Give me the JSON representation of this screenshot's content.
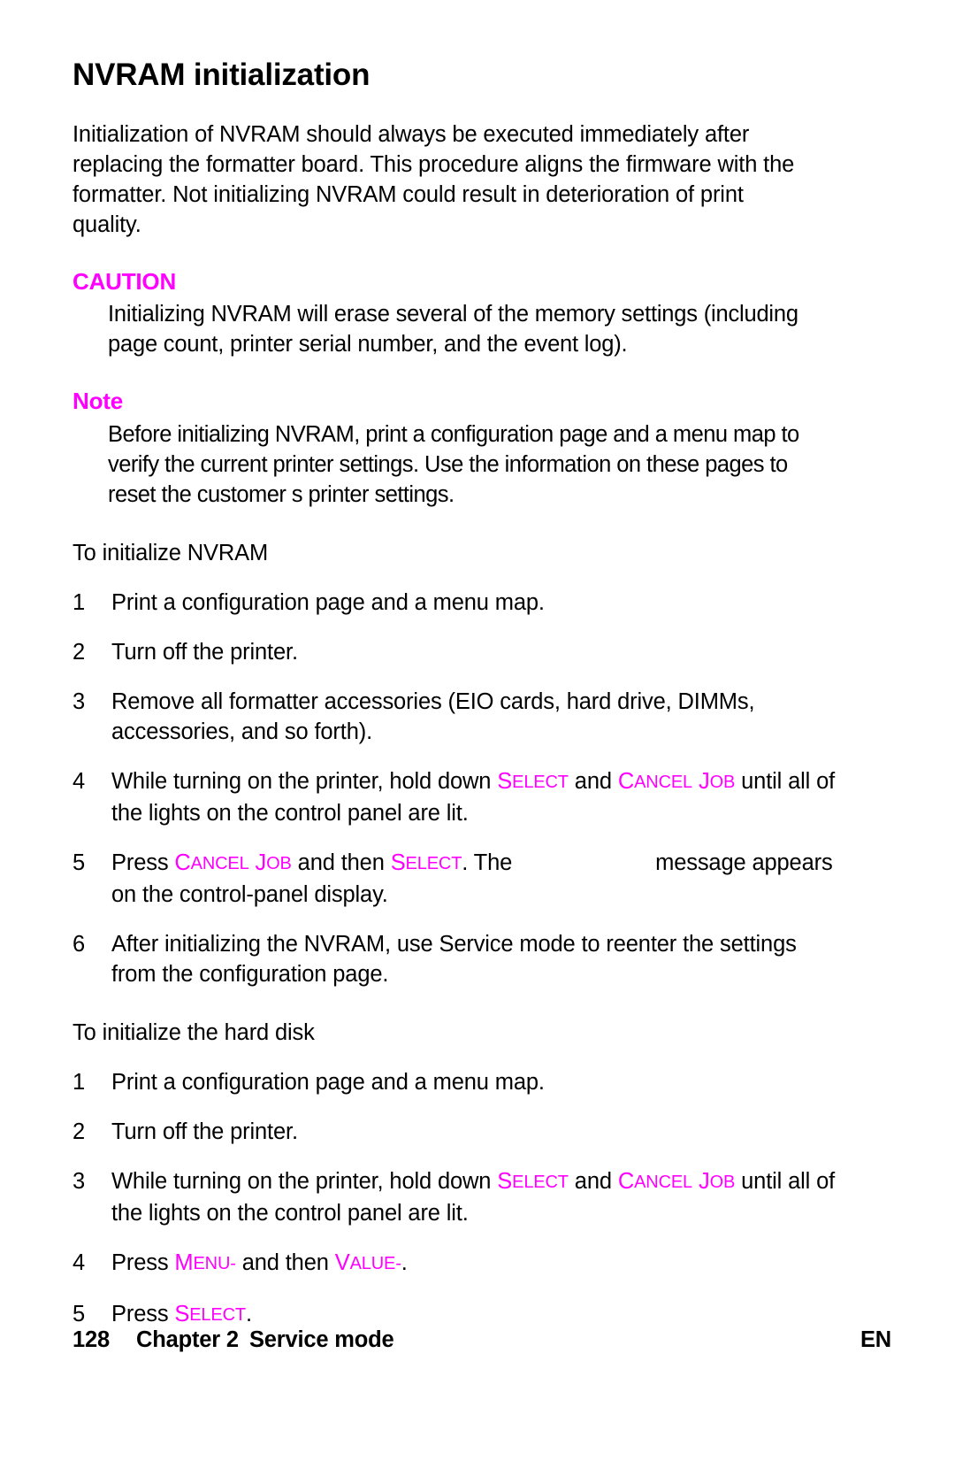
{
  "page": {
    "title": "NVRAM initialization",
    "intro": "Initialization of NVRAM should always be executed immediately after replacing the formatter board. This procedure aligns the firmware with the formatter. Not initializing NVRAM could result in deterioration of print quality."
  },
  "caution": {
    "label": "CAUTION",
    "body": "Initializing NVRAM will erase several of the memory settings (including page count, printer serial number, and the event log).",
    "color": "#ff00ff"
  },
  "note": {
    "label": "Note",
    "body": "Before initializing NVRAM, print a configuration page and a menu map to verify the current printer settings. Use the information on these pages to reset the customer s printer settings.",
    "color": "#ff00ff"
  },
  "nvram_section": {
    "heading": "To initialize NVRAM",
    "steps": [
      {
        "num": "1",
        "text": "Print a configuration page and a menu map."
      },
      {
        "num": "2",
        "text": "Turn off the printer."
      },
      {
        "num": "3",
        "text": "Remove all formatter accessories (EIO cards, hard drive, DIMMs, accessories, and so forth)."
      },
      {
        "num": "4",
        "prefix": "While turning on the printer, hold down ",
        "key1_cap": "S",
        "key1_rest": "ELECT",
        "middle": " and ",
        "key2_cap": "C",
        "key2_rest": "ANCEL",
        "key2_cap2": "J",
        "key2_rest2": "OB",
        "suffix": " until all of the lights on the control panel are lit."
      },
      {
        "num": "5",
        "prefix": "Press ",
        "key1_cap": "C",
        "key1_rest": "ANCEL",
        "key1_cap2": "J",
        "key1_rest2": "OB",
        "middle": " and then ",
        "key2_cap": "S",
        "key2_rest": "ELECT",
        "after_keys": ". The ",
        "suffix": "message appears on the control-panel display."
      },
      {
        "num": "6",
        "text": "After initializing the NVRAM, use Service mode to reenter the settings from the configuration page."
      }
    ]
  },
  "harddisk_section": {
    "heading": "To initialize the hard disk",
    "steps": [
      {
        "num": "1",
        "text": "Print a configuration page and a menu map."
      },
      {
        "num": "2",
        "text": "Turn off the printer."
      },
      {
        "num": "3",
        "prefix": "While turning on the printer, hold down ",
        "key1_cap": "S",
        "key1_rest": "ELECT",
        "middle": " and ",
        "key2_cap": "C",
        "key2_rest": "ANCEL",
        "key2_cap2": "J",
        "key2_rest2": "OB",
        "suffix": " until all of the lights on the control panel are lit."
      },
      {
        "num": "4",
        "prefix": "Press ",
        "key1_cap": "M",
        "key1_rest": "ENU-",
        "middle": " and then ",
        "key2_cap": "V",
        "key2_rest": "ALUE-",
        "suffix": "."
      },
      {
        "num": "5",
        "prefix": "Press ",
        "key1_cap": "S",
        "key1_rest": "ELECT",
        "suffix": "."
      }
    ]
  },
  "footer": {
    "page_number": "128",
    "chapter": "Chapter 2",
    "section": "Service mode",
    "language": "EN"
  }
}
